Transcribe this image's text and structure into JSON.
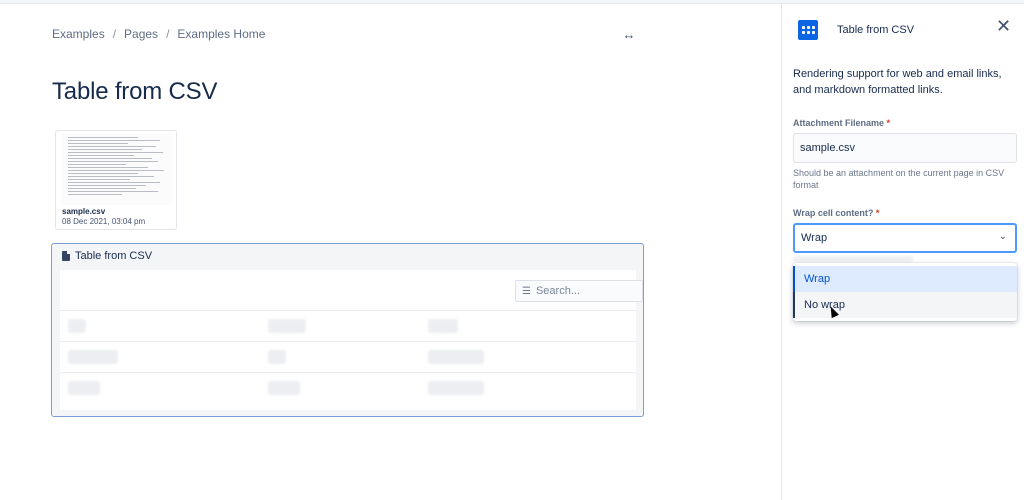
{
  "breadcrumb": [
    "Examples",
    "Pages",
    "Examples Home"
  ],
  "page": {
    "title": "Table from CSV"
  },
  "attachment": {
    "filename": "sample.csv",
    "date": "08 Dec 2021, 03:04 pm"
  },
  "macro": {
    "title": "Table from CSV",
    "search_placeholder": "Search..."
  },
  "panel": {
    "title": "Table from CSV",
    "description": "Rendering support for web and email links, and markdown formatted links.",
    "filename_label": "Attachment Filename",
    "filename_value": "sample.csv",
    "filename_help": "Should be an attachment on the current page in CSV format",
    "wrap_label": "Wrap cell content?",
    "wrap_value": "Wrap",
    "options": [
      "Wrap",
      "No wrap"
    ],
    "required_mark": "*"
  },
  "colors": {
    "accent": "#0c66e4",
    "selected_bg": "#deebff",
    "focus_border": "#4c9aff",
    "required": "#de350b"
  },
  "icons": [
    "width-toggle-icon",
    "doc-icon",
    "filter-icon",
    "close-icon",
    "chevron-down-icon",
    "macro-icon"
  ]
}
